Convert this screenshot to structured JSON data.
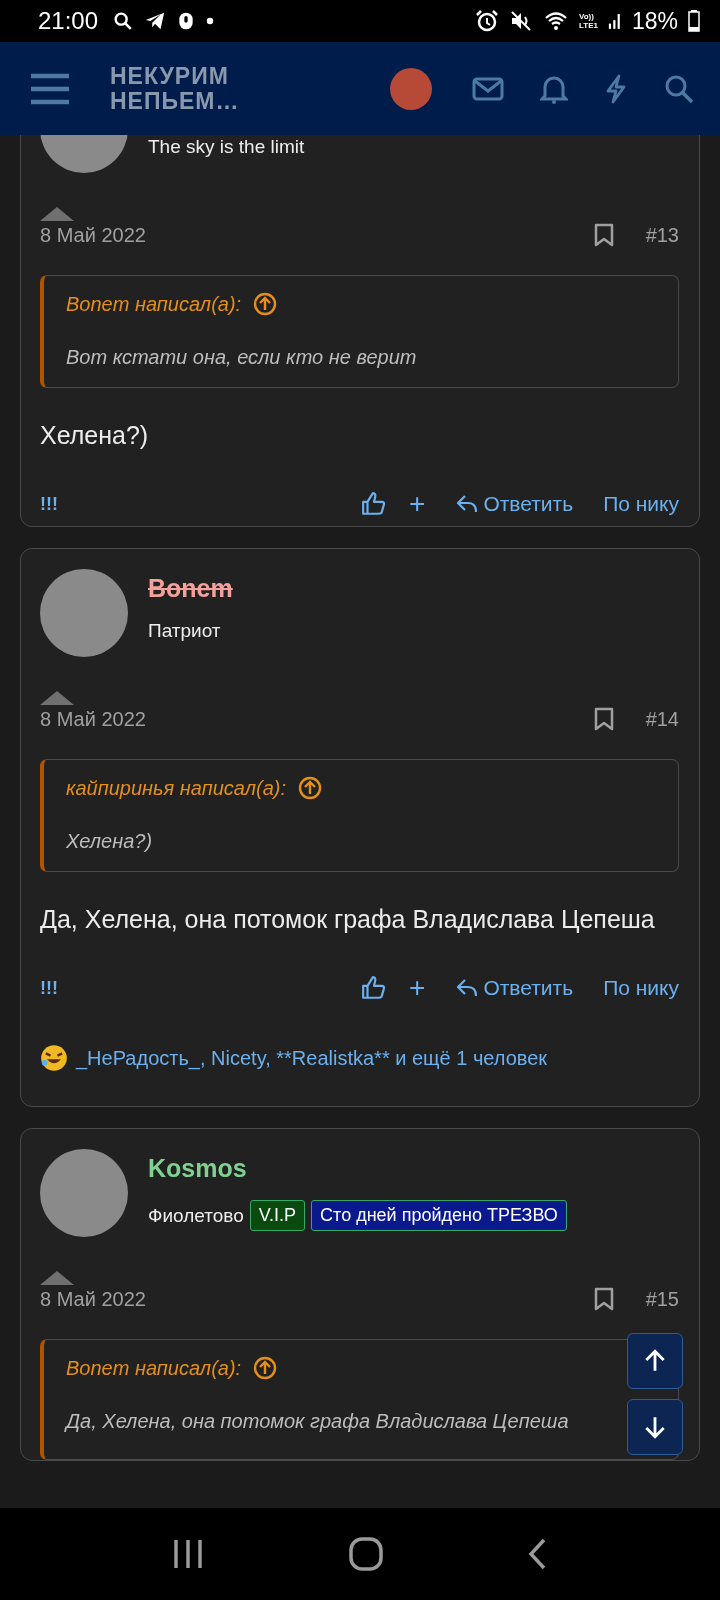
{
  "status_bar": {
    "time": "21:00",
    "network_label": [
      "Vo))",
      "LTE1"
    ],
    "battery": "18%"
  },
  "header": {
    "logo_lines": [
      "НЕКУРИМ",
      "НЕПЬЕМ…"
    ]
  },
  "posts": [
    {
      "user": {
        "title": "The sky is the limit"
      },
      "date": "8 Май 2022",
      "number": "#13",
      "quote": {
        "author": "Bonem написал(а):",
        "text": "Вот кстати она, если кто не верит"
      },
      "body": "Хелена?)",
      "actions": {
        "report": "!!!",
        "plus": "+",
        "reply": "Ответить",
        "mention": "По нику"
      }
    },
    {
      "user": {
        "name": "Bonem",
        "color": "#f4a19c",
        "banned": true,
        "title": "Патриот"
      },
      "date": "8 Май 2022",
      "number": "#14",
      "quote": {
        "author": "кайпиринья написал(а):",
        "text": "Хелена?)"
      },
      "body": "Да, Хелена, она потомок графа Владислава Цепеша",
      "actions": {
        "report": "!!!",
        "plus": "+",
        "reply": "Ответить",
        "mention": "По нику"
      },
      "reactions": "_НеРадость_, Nicety, **Realistka** и ещё 1 человек"
    },
    {
      "user": {
        "name": "Kosmos",
        "color": "#7fd18f",
        "banned": false,
        "title": "Фиолетово",
        "banners": [
          {
            "label": "V.I.P",
            "color": "#0b4a0f"
          },
          {
            "label": "Сто дней пройдено ТРЕЗВО",
            "color": "#0a1a8c"
          }
        ]
      },
      "date": "8 Май 2022",
      "number": "#15",
      "quote": {
        "author": "Bonem написал(а):",
        "text": "Да, Хелена, она потомок графа Владислава Цепеша"
      }
    }
  ]
}
